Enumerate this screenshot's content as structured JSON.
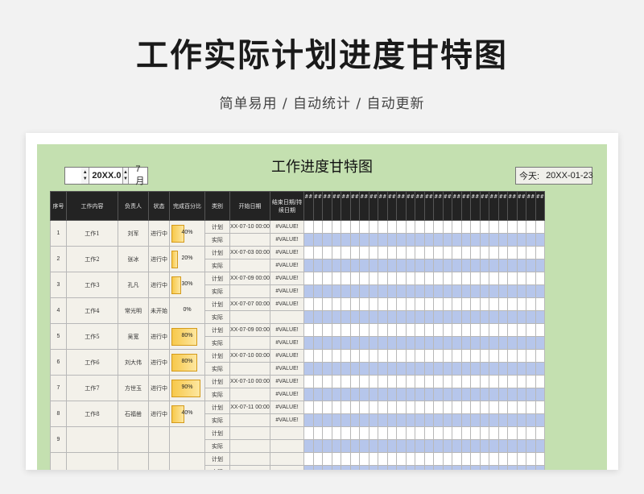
{
  "header": {
    "title": "工作实际计划进度甘特图",
    "subtitle": "简单易用 / 自动统计 / 自动更新"
  },
  "sheet": {
    "title": "工作进度甘特图",
    "year_value": "20XX.0",
    "month_value": "7月",
    "today_label": "今天:",
    "today_value": "20XX-01-23"
  },
  "table": {
    "columns": [
      "序号",
      "工作内容",
      "负责人",
      "状态",
      "完成百分比",
      "类别",
      "开始日期",
      "结束日期/持续日期"
    ],
    "date_header": "##",
    "date_column_count": 26,
    "plan_label": "计划",
    "actual_label": "实际",
    "rows": [
      {
        "no": "1",
        "task": "工作1",
        "owner": "刘军",
        "status": "进行中",
        "percent": "40%",
        "progress": 0.4,
        "start": "XX-07-10 00:00",
        "end": "#VALUE!",
        "actual_end": "#VALUE!"
      },
      {
        "no": "2",
        "task": "工作2",
        "owner": "张冰",
        "status": "进行中",
        "percent": "20%",
        "progress": 0.2,
        "start": "XX-07-03 00:00",
        "end": "#VALUE!",
        "actual_end": "#VALUE!"
      },
      {
        "no": "3",
        "task": "工作3",
        "owner": "孔凡",
        "status": "进行中",
        "percent": "30%",
        "progress": 0.3,
        "start": "XX-07-09 00:00",
        "end": "#VALUE!",
        "actual_end": "#VALUE!"
      },
      {
        "no": "4",
        "task": "工作4",
        "owner": "常光明",
        "status": "未开始",
        "percent": "0%",
        "progress": 0,
        "start": "XX-07-07 00:00",
        "end": "#VALUE!",
        "actual_end": ""
      },
      {
        "no": "5",
        "task": "工作5",
        "owner": "吴宽",
        "status": "进行中",
        "percent": "80%",
        "progress": 0.8,
        "start": "XX-07-09 00:00",
        "end": "#VALUE!",
        "actual_end": "#VALUE!"
      },
      {
        "no": "6",
        "task": "工作6",
        "owner": "刘大伟",
        "status": "进行中",
        "percent": "80%",
        "progress": 0.8,
        "start": "XX-07-10 00:00",
        "end": "#VALUE!",
        "actual_end": "#VALUE!"
      },
      {
        "no": "7",
        "task": "工作7",
        "owner": "方世玉",
        "status": "进行中",
        "percent": "90%",
        "progress": 0.9,
        "start": "XX-07-10 00:00",
        "end": "#VALUE!",
        "actual_end": "#VALUE!"
      },
      {
        "no": "8",
        "task": "工作8",
        "owner": "石福凿",
        "status": "进行中",
        "percent": "40%",
        "progress": 0.4,
        "start": "XX-07-11 00:00",
        "end": "#VALUE!",
        "actual_end": "#VALUE!"
      },
      {
        "no": "9",
        "task": "",
        "owner": "",
        "status": "",
        "percent": "",
        "progress": null,
        "start": "",
        "end": "",
        "actual_end": ""
      },
      {
        "no": "",
        "task": "",
        "owner": "",
        "status": "",
        "percent": "",
        "progress": null,
        "start": "",
        "end": "",
        "actual_end": ""
      }
    ]
  }
}
